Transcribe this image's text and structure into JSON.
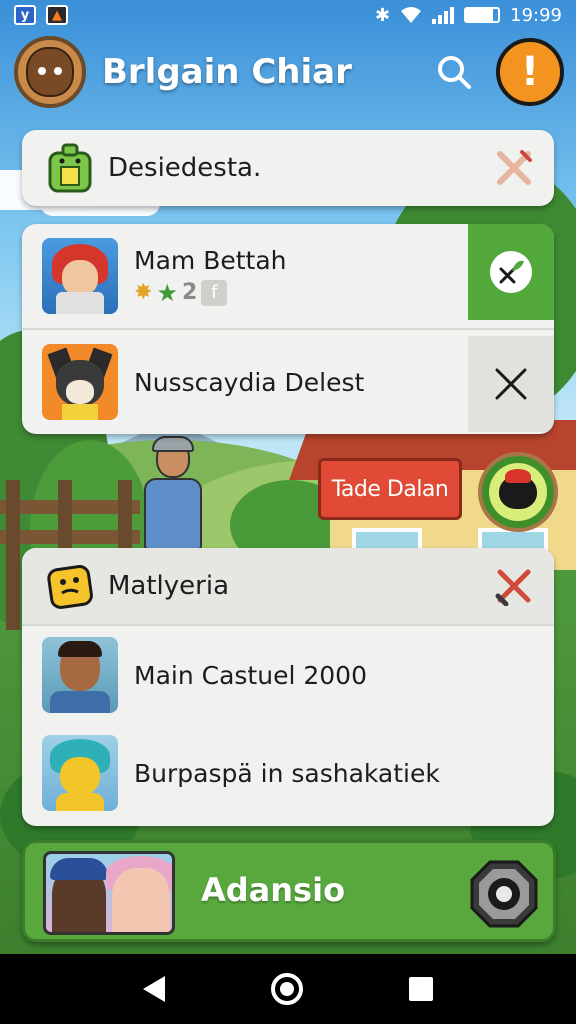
{
  "status_bar": {
    "time": "19:99",
    "notif_icon_1": "y",
    "icons": [
      "app-notification-icon",
      "game-notification-icon",
      "bluetooth-icon",
      "wifi-icon",
      "signal-icon",
      "battery-icon"
    ]
  },
  "header": {
    "title": "Brlgain Chiar",
    "alert_label": "!"
  },
  "card1": {
    "title": "Desiedesta."
  },
  "card2": {
    "row1": {
      "name": "Mam Bettah",
      "count": "2",
      "chip": "f"
    },
    "row2": {
      "name": "Nusscaydia Delest"
    }
  },
  "scene": {
    "shop_sign": "Tade Dalan"
  },
  "card3": {
    "title": "Matlyeria",
    "row1": {
      "name": "Main Castuel 2000"
    },
    "row2": {
      "name": "Burpaspä in sashakatiek"
    }
  },
  "action_bar": {
    "label": "Adansio"
  },
  "colors": {
    "accent_green": "#52a83a",
    "alert_orange": "#f39420",
    "sign_red": "#e04a36"
  }
}
